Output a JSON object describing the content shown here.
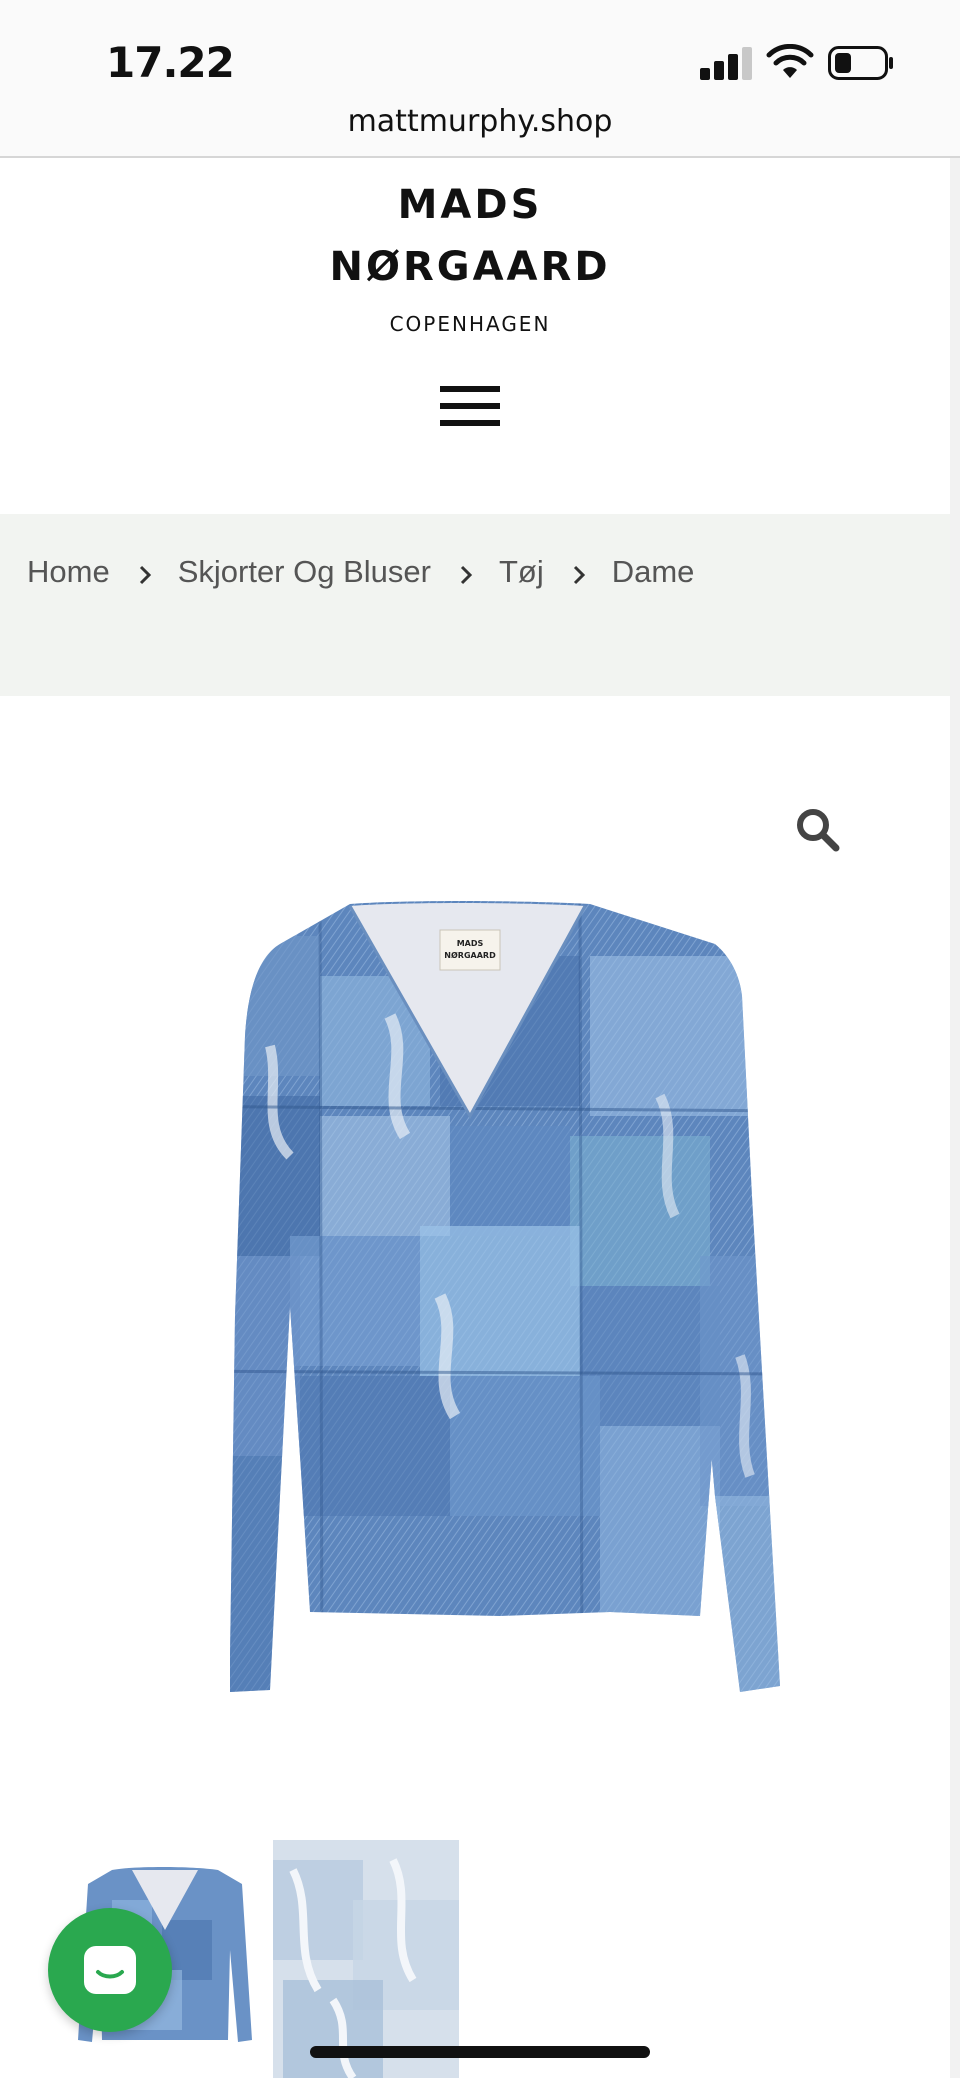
{
  "status_bar": {
    "time": "17.22"
  },
  "browser": {
    "url": "mattmurphy.shop"
  },
  "header": {
    "brand_line1": "MADS",
    "brand_line2": "NØRGAARD",
    "brand_line3": "COPENHAGEN",
    "menu_icon": "hamburger-menu-icon"
  },
  "breadcrumb": [
    "Home",
    "Skjorter Og Bluser",
    "Tøj",
    "Dame"
  ],
  "product": {
    "zoom_icon": "search-icon",
    "image_label_line1": "MADS",
    "image_label_line2": "NØRGAARD"
  },
  "thumbnails": [
    "thumbnail-front",
    "thumbnail-detail"
  ],
  "chat": {
    "icon": "chat-bubble-icon",
    "color": "#2aa84f"
  }
}
